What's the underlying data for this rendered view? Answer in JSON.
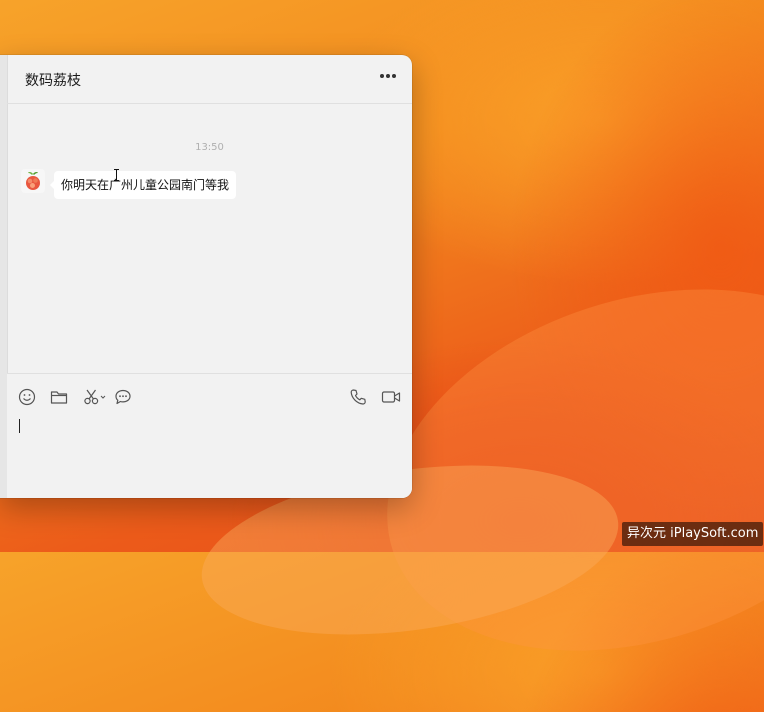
{
  "chat": {
    "title": "数码荔枝",
    "timestamp": "13:50",
    "messages": [
      {
        "sender": "数码荔枝",
        "avatar": "lychee-avatar",
        "text": "你明天在广州儿童公园南门等我"
      }
    ]
  },
  "toolbar": {
    "left_icons": [
      "emoji-icon",
      "folder-icon",
      "scissors-icon",
      "chat-bubble-icon"
    ],
    "right_icons": [
      "phone-icon",
      "video-icon"
    ]
  },
  "input": {
    "value": ""
  },
  "watermark": {
    "text": "异次元 iPlaySoft.com"
  },
  "colors": {
    "window_bg": "#f2f2f2",
    "bubble_bg": "#ffffff",
    "desktop_orange": "#f38a1e",
    "desktop_red": "#e44a18"
  }
}
